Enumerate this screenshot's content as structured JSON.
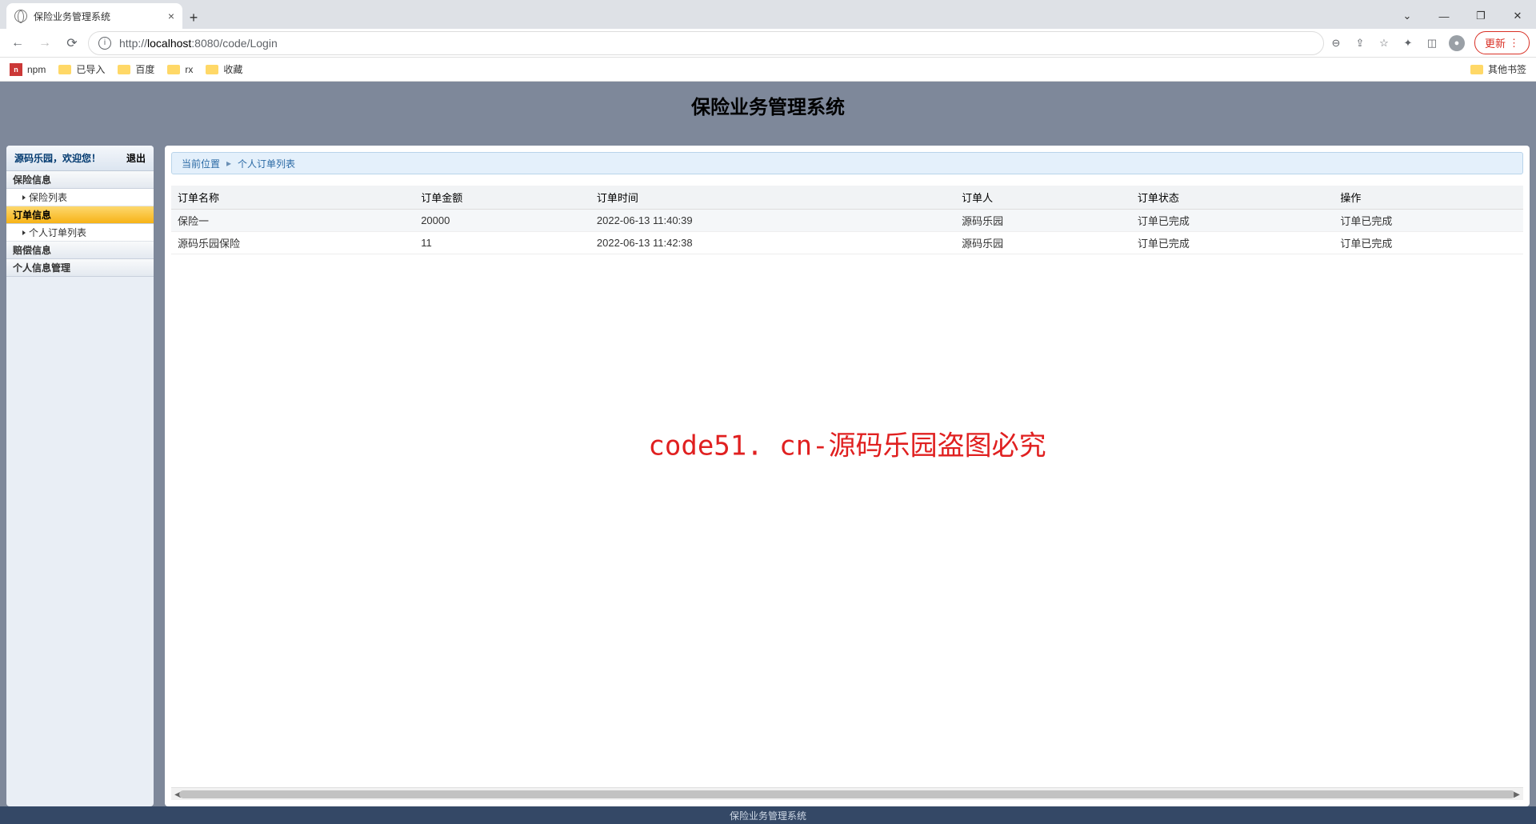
{
  "browser": {
    "tab_title": "保险业务管理系统",
    "url_prefix": "http://",
    "url_host": "localhost",
    "url_port": ":8080",
    "url_path": "/code/Login",
    "update_label": "更新",
    "bookmarks": [
      "npm",
      "已导入",
      "百度",
      "rx",
      "收藏"
    ],
    "other_bookmarks": "其他书签"
  },
  "app": {
    "title": "保险业务管理系统",
    "footer": "保险业务管理系统"
  },
  "sidebar": {
    "welcome": "源码乐园，欢迎您！",
    "logout": "退出",
    "sections": [
      {
        "label": "保险信息",
        "active": false,
        "items": [
          {
            "label": "保险列表"
          }
        ]
      },
      {
        "label": "订单信息",
        "active": true,
        "items": [
          {
            "label": "个人订单列表"
          }
        ]
      },
      {
        "label": "赔偿信息",
        "active": false,
        "items": []
      },
      {
        "label": "个人信息管理",
        "active": false,
        "items": []
      }
    ]
  },
  "breadcrumb": {
    "label": "当前位置",
    "current": "个人订单列表"
  },
  "table": {
    "headers": [
      "订单名称",
      "订单金额",
      "订单时间",
      "订单人",
      "订单状态",
      "操作"
    ],
    "rows": [
      {
        "name": "保险一",
        "amount": "20000",
        "time": "2022-06-13 11:40:39",
        "user": "源码乐园",
        "status": "订单已完成",
        "action": "订单已完成"
      },
      {
        "name": "源码乐园保险",
        "amount": "11",
        "time": "2022-06-13 11:42:38",
        "user": "源码乐园",
        "status": "订单已完成",
        "action": "订单已完成"
      }
    ]
  },
  "watermark": "code51. cn-源码乐园盗图必究"
}
